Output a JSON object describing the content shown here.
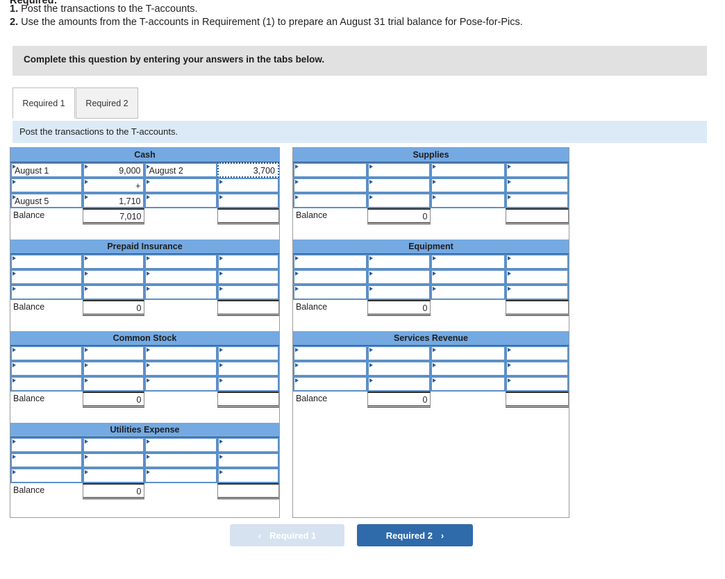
{
  "requirement": {
    "heading": "Required:",
    "items": [
      {
        "num": "1.",
        "text": "Post the transactions to the T-accounts."
      },
      {
        "num": "2.",
        "text": "Use the amounts from the T-accounts in Requirement (1) to prepare an August 31 trial balance for Pose-for-Pics."
      }
    ]
  },
  "banner": {
    "text": "Complete this question by entering your answers in the tabs below."
  },
  "tabs": [
    {
      "label": "Required 1",
      "active": true
    },
    {
      "label": "Required 2",
      "active": false
    }
  ],
  "instruction": {
    "text": "Post the transactions to the T-accounts."
  },
  "colors": {
    "account_header_blue": "#74A9E2",
    "instruction_blue": "#DCEAF7",
    "banner_gray": "#E1E1E1",
    "cell_border_blue": "#5C90C8",
    "next_button_blue": "#2F6AAB",
    "prev_button_blue": "#D6E2F0"
  },
  "accounts": {
    "left": [
      {
        "title": "Cash",
        "rows": [
          {
            "cells": [
              {
                "text": "August 1",
                "type": "input",
                "align": "left"
              },
              {
                "text": "9,000",
                "type": "input",
                "align": "right"
              },
              {
                "text": "August 2",
                "type": "input",
                "align": "left"
              },
              {
                "text": "3,700",
                "type": "input",
                "align": "right",
                "selected": true
              }
            ]
          },
          {
            "cells": [
              {
                "text": "",
                "type": "input",
                "align": "left"
              },
              {
                "text": "+",
                "type": "input",
                "align": "right"
              },
              {
                "text": "",
                "type": "input",
                "align": "left"
              },
              {
                "text": "",
                "type": "input",
                "align": "right"
              }
            ]
          },
          {
            "cells": [
              {
                "text": "August 5",
                "type": "input",
                "align": "left"
              },
              {
                "text": "1,710",
                "type": "input",
                "align": "right"
              },
              {
                "text": "",
                "type": "input",
                "align": "left"
              },
              {
                "text": "",
                "type": "input",
                "align": "right"
              }
            ]
          }
        ],
        "balance": {
          "label": "Balance",
          "debit": "7,010",
          "credit_label": "",
          "credit": ""
        }
      },
      {
        "title": "Prepaid Insurance",
        "rows": [
          {
            "cells": [
              {
                "text": "",
                "type": "input",
                "align": "left"
              },
              {
                "text": "",
                "type": "input",
                "align": "right"
              },
              {
                "text": "",
                "type": "input",
                "align": "left"
              },
              {
                "text": "",
                "type": "input",
                "align": "right"
              }
            ]
          },
          {
            "cells": [
              {
                "text": "",
                "type": "input",
                "align": "left"
              },
              {
                "text": "",
                "type": "input",
                "align": "right"
              },
              {
                "text": "",
                "type": "input",
                "align": "left"
              },
              {
                "text": "",
                "type": "input",
                "align": "right"
              }
            ]
          },
          {
            "cells": [
              {
                "text": "",
                "type": "input",
                "align": "left"
              },
              {
                "text": "",
                "type": "input",
                "align": "right"
              },
              {
                "text": "",
                "type": "input",
                "align": "left"
              },
              {
                "text": "",
                "type": "input",
                "align": "right"
              }
            ]
          }
        ],
        "balance": {
          "label": "Balance",
          "debit": "0",
          "credit_label": "",
          "credit": ""
        }
      },
      {
        "title": "Common Stock",
        "rows": [
          {
            "cells": [
              {
                "text": "",
                "type": "input",
                "align": "left"
              },
              {
                "text": "",
                "type": "input",
                "align": "right"
              },
              {
                "text": "",
                "type": "input",
                "align": "left"
              },
              {
                "text": "",
                "type": "input",
                "align": "right"
              }
            ]
          },
          {
            "cells": [
              {
                "text": "",
                "type": "input",
                "align": "left"
              },
              {
                "text": "",
                "type": "input",
                "align": "right"
              },
              {
                "text": "",
                "type": "input",
                "align": "left"
              },
              {
                "text": "",
                "type": "input",
                "align": "right"
              }
            ]
          },
          {
            "cells": [
              {
                "text": "",
                "type": "input",
                "align": "left"
              },
              {
                "text": "",
                "type": "input",
                "align": "right"
              },
              {
                "text": "",
                "type": "input",
                "align": "left"
              },
              {
                "text": "",
                "type": "input",
                "align": "right"
              }
            ]
          }
        ],
        "balance": {
          "label": "Balance",
          "debit": "0",
          "credit_label": "",
          "credit": ""
        }
      },
      {
        "title": "Utilities Expense",
        "rows": [
          {
            "cells": [
              {
                "text": "",
                "type": "input",
                "align": "left"
              },
              {
                "text": "",
                "type": "input",
                "align": "right"
              },
              {
                "text": "",
                "type": "input",
                "align": "left"
              },
              {
                "text": "",
                "type": "input",
                "align": "right"
              }
            ]
          },
          {
            "cells": [
              {
                "text": "",
                "type": "input",
                "align": "left"
              },
              {
                "text": "",
                "type": "input",
                "align": "right"
              },
              {
                "text": "",
                "type": "input",
                "align": "left"
              },
              {
                "text": "",
                "type": "input",
                "align": "right"
              }
            ]
          },
          {
            "cells": [
              {
                "text": "",
                "type": "input",
                "align": "left"
              },
              {
                "text": "",
                "type": "input",
                "align": "right"
              },
              {
                "text": "",
                "type": "input",
                "align": "left"
              },
              {
                "text": "",
                "type": "input",
                "align": "right"
              }
            ]
          }
        ],
        "balance": {
          "label": "Balance",
          "debit": "0",
          "credit_label": "",
          "credit": ""
        }
      }
    ],
    "right": [
      {
        "title": "Supplies",
        "rows": [
          {
            "cells": [
              {
                "text": "",
                "type": "input",
                "align": "left"
              },
              {
                "text": "",
                "type": "input",
                "align": "right"
              },
              {
                "text": "",
                "type": "input",
                "align": "left"
              },
              {
                "text": "",
                "type": "input",
                "align": "right"
              }
            ]
          },
          {
            "cells": [
              {
                "text": "",
                "type": "input",
                "align": "left"
              },
              {
                "text": "",
                "type": "input",
                "align": "right"
              },
              {
                "text": "",
                "type": "input",
                "align": "left"
              },
              {
                "text": "",
                "type": "input",
                "align": "right"
              }
            ]
          },
          {
            "cells": [
              {
                "text": "",
                "type": "input",
                "align": "left"
              },
              {
                "text": "",
                "type": "input",
                "align": "right"
              },
              {
                "text": "",
                "type": "input",
                "align": "left"
              },
              {
                "text": "",
                "type": "input",
                "align": "right"
              }
            ]
          }
        ],
        "balance": {
          "label": "Balance",
          "debit": "0",
          "credit_label": "",
          "credit": ""
        }
      },
      {
        "title": "Equipment",
        "rows": [
          {
            "cells": [
              {
                "text": "",
                "type": "input",
                "align": "left"
              },
              {
                "text": "",
                "type": "input",
                "align": "right"
              },
              {
                "text": "",
                "type": "input",
                "align": "left"
              },
              {
                "text": "",
                "type": "input",
                "align": "right"
              }
            ]
          },
          {
            "cells": [
              {
                "text": "",
                "type": "input",
                "align": "left"
              },
              {
                "text": "",
                "type": "input",
                "align": "right"
              },
              {
                "text": "",
                "type": "input",
                "align": "left"
              },
              {
                "text": "",
                "type": "input",
                "align": "right"
              }
            ]
          },
          {
            "cells": [
              {
                "text": "",
                "type": "input",
                "align": "left"
              },
              {
                "text": "",
                "type": "input",
                "align": "right"
              },
              {
                "text": "",
                "type": "input",
                "align": "left"
              },
              {
                "text": "",
                "type": "input",
                "align": "right"
              }
            ]
          }
        ],
        "balance": {
          "label": "Balance",
          "debit": "0",
          "credit_label": "",
          "credit": ""
        }
      },
      {
        "title": "Services Revenue",
        "rows": [
          {
            "cells": [
              {
                "text": "",
                "type": "input",
                "align": "left"
              },
              {
                "text": "",
                "type": "input",
                "align": "right"
              },
              {
                "text": "",
                "type": "input",
                "align": "left"
              },
              {
                "text": "",
                "type": "input",
                "align": "right"
              }
            ]
          },
          {
            "cells": [
              {
                "text": "",
                "type": "input",
                "align": "left"
              },
              {
                "text": "",
                "type": "input",
                "align": "right"
              },
              {
                "text": "",
                "type": "input",
                "align": "left"
              },
              {
                "text": "",
                "type": "input",
                "align": "right"
              }
            ]
          },
          {
            "cells": [
              {
                "text": "",
                "type": "input",
                "align": "left"
              },
              {
                "text": "",
                "type": "input",
                "align": "right"
              },
              {
                "text": "",
                "type": "input",
                "align": "left"
              },
              {
                "text": "",
                "type": "input",
                "align": "right"
              }
            ]
          }
        ],
        "balance": {
          "label": "Balance",
          "debit": "0",
          "credit_label": "",
          "credit": ""
        }
      }
    ]
  },
  "nav": {
    "prev": {
      "label": "Required 1",
      "chevron": "‹"
    },
    "next": {
      "label": "Required 2",
      "chevron": "›"
    }
  }
}
